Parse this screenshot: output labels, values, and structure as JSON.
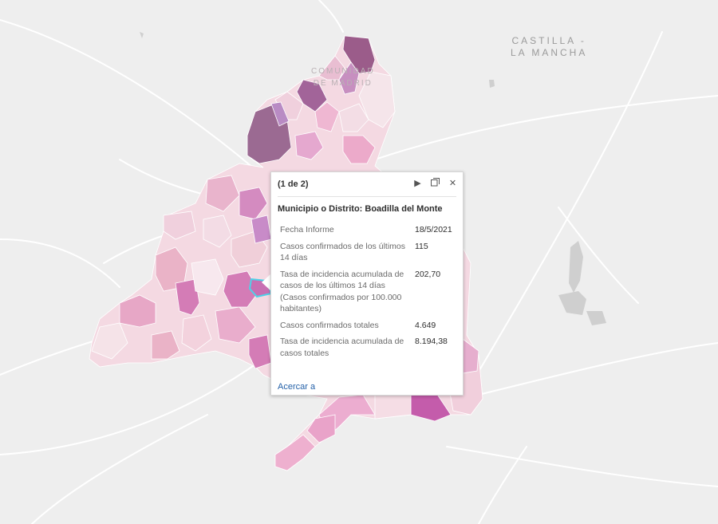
{
  "map": {
    "region_labels": {
      "castilla_line1": "CASTILLA -",
      "castilla_line2": "LA MANCHA",
      "comunidad_line1": "COMUNIDAD",
      "comunidad_line2": "DE MADRID"
    },
    "colors": {
      "background": "#eeeeee",
      "roads": "#ffffff",
      "water": "#c8c8c8",
      "highlight_outline": "#4fd1e8",
      "choropleth_scale": [
        "#f5e6ea",
        "#f0cfd9",
        "#eab3c7",
        "#e097bd",
        "#d47cb6",
        "#9b5c8a"
      ]
    }
  },
  "popup": {
    "header": "(1 de 2)",
    "title": "Municipio o Distrito: Boadilla del Monte",
    "fields": [
      {
        "label": "Fecha Informe",
        "value": "18/5/2021"
      },
      {
        "label": "Casos confirmados de los últimos 14 días",
        "value": "115"
      },
      {
        "label": "Tasa de incidencia acumulada de casos de los últimos 14 días (Casos confirmados por 100.000 habitantes)",
        "value": "202,70"
      },
      {
        "label": "Casos confirmados totales",
        "value": "4.649"
      },
      {
        "label": "Tasa de incidencia acumulada de casos totales",
        "value": "8.194,38"
      }
    ],
    "zoom_link": "Acercar a",
    "icons": {
      "next": "play-icon",
      "dock": "dock-icon",
      "close": "close-icon"
    }
  }
}
